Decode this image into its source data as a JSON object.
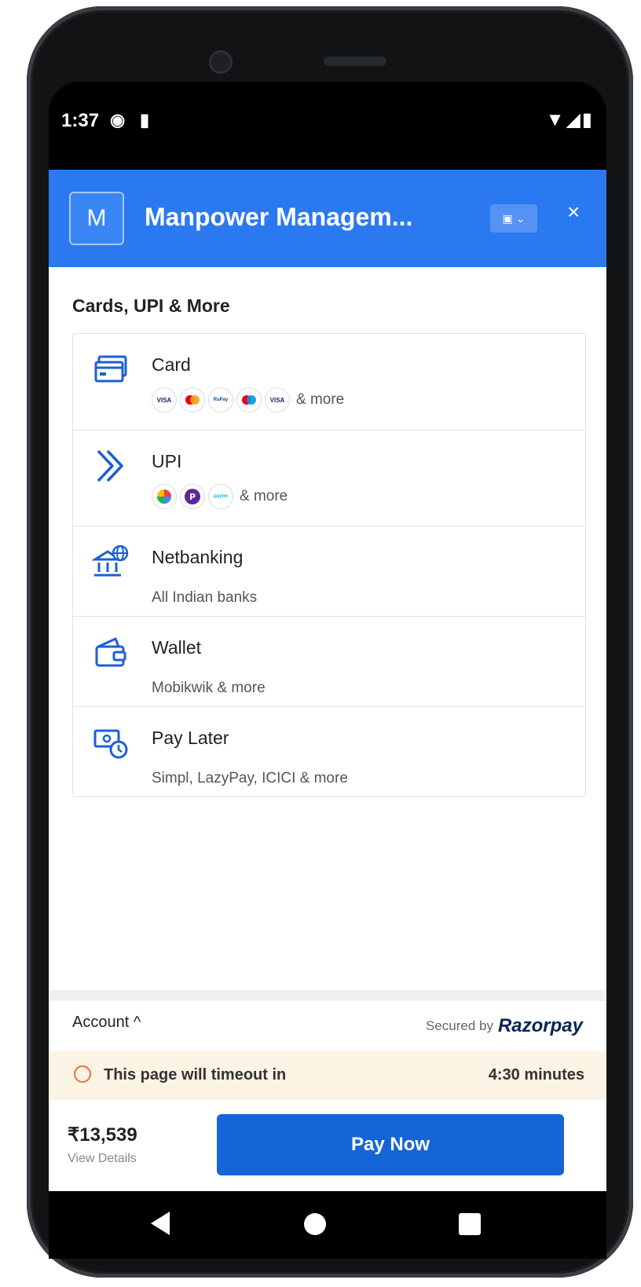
{
  "status_bar": {
    "time": "1:37"
  },
  "header": {
    "logo_letter": "M",
    "merchant_name": "Manpower Managem...",
    "close_symbol": "×"
  },
  "section_title": "Cards, UPI & More",
  "methods": [
    {
      "title": "Card",
      "icon": "card-icon",
      "chips": [
        "VISA",
        "MC",
        "RuPay",
        "Maestro",
        "VISA"
      ],
      "more": "& more"
    },
    {
      "title": "UPI",
      "icon": "upi-icon",
      "chips": [
        "GPay",
        "PhonePe",
        "paytm"
      ],
      "more": "& more"
    },
    {
      "title": "Netbanking",
      "icon": "bank-icon",
      "subtitle": "All Indian banks"
    },
    {
      "title": "Wallet",
      "icon": "wallet-icon",
      "subtitle": "Mobikwik & more"
    },
    {
      "title": "Pay Later",
      "icon": "paylater-icon",
      "subtitle": "Simpl, LazyPay, ICICI & more"
    }
  ],
  "footer": {
    "account_label": "Account ^",
    "secured_label": "Secured by",
    "brand": "Razorpay"
  },
  "timeout": {
    "text": "This page will timeout in",
    "value": "4:30 minutes"
  },
  "pay": {
    "amount": "₹13,539",
    "details": "View Details",
    "button": "Pay Now"
  },
  "colors": {
    "header": "#2b79f1",
    "button": "#1565d8",
    "icon_blue": "#1a5fd6",
    "timeout_bg": "#fbf3e4",
    "clock": "#e8713d"
  }
}
